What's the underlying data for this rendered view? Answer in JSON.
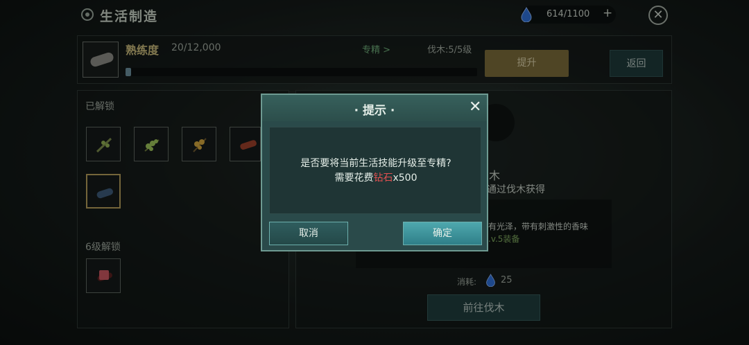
{
  "header": {
    "title": "生活制造",
    "resource_value": "614/1100",
    "add_label": "+",
    "close_label": "✕"
  },
  "strip": {
    "proficiency_label": "熟练度",
    "proficiency_value": "20/12,000",
    "progress_fraction": 0.0017,
    "spec_link": "专精 >",
    "level_text": "伐木:5/5级",
    "upgrade_label": "提升",
    "back_label": "返回"
  },
  "left": {
    "unlocked_label": "已解锁",
    "lock6_label": "6级解锁"
  },
  "right": {
    "item_name": "木",
    "item_source": "通过伐木获得",
    "desc_line1": "有光泽，带有刺激性的香味",
    "desc_line2": ".v.5装备",
    "cost_label": "消耗:",
    "cost_value": "25",
    "go_label": "前往伐木"
  },
  "dialog": {
    "title": "· 提示 ·",
    "close_label": "✕",
    "message_line1": "是否要将当前生活技能升级至专精?",
    "message_prefix": "需要花费",
    "message_highlight": "钻石",
    "message_suffix": "x500",
    "cancel_label": "取消",
    "ok_label": "确定"
  },
  "colors": {
    "accent_gold": "#c9ba7c",
    "highlight_red": "#e05050",
    "teal_button": "#4fa8ae"
  }
}
